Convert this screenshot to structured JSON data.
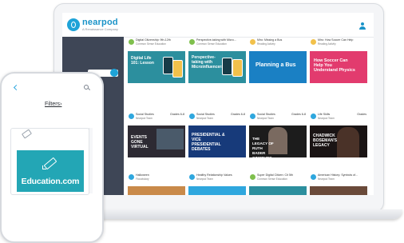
{
  "laptop": {
    "brand": "nearpod",
    "tagline": "A Renaissance Company",
    "row1": [
      {
        "title": "Digital Citizenship: 9th-12th",
        "subtitle": "Common Sense Education",
        "grade": "",
        "thumb_text": "Digital Life 101: Lesson",
        "theme": "#2c8f9e"
      },
      {
        "title": "Perspective-taking with Micro...",
        "subtitle": "Common Sense Education",
        "grade": "",
        "thumb_text": "Perspective-taking with Microinfluencers",
        "theme": "#2c8f9e"
      },
      {
        "title": "Miro: Missing a Bus",
        "subtitle": "Reading Activity",
        "grade": "",
        "thumb_text": "Planning a Bus",
        "theme": "#1a80c4"
      },
      {
        "title": "Miro: How Soccer Can Help",
        "subtitle": "Reading Activity",
        "grade": "",
        "thumb_text": "How Soccer Can Help You Understand Physics",
        "theme": "#e23b6e"
      }
    ],
    "row2": [
      {
        "title": "Social Studies",
        "subtitle": "Nearpod Team",
        "grade": "Grades 6-8",
        "thumb_text": "EVENTS GONE VIRTUAL",
        "theme": "#2d2a33"
      },
      {
        "title": "Social Studies",
        "subtitle": "Nearpod Team",
        "grade": "Grades 6-8",
        "thumb_text": "PRESIDENTIAL & VICE PRESIDENTIAL DEBATES",
        "theme": "#173a7a"
      },
      {
        "title": "Social Studies",
        "subtitle": "Nearpod Team",
        "grade": "Grades 6-8",
        "thumb_text": "THE LEGACY OF RUTH BADER GINSBURG",
        "theme": "#1c1c1c"
      },
      {
        "title": "Life Skills",
        "subtitle": "Nearpod Team",
        "grade": "Grades",
        "thumb_text": "CHADWICK BOSEMAN'S LEGACY",
        "theme": "#1a1414"
      }
    ],
    "row3": [
      {
        "title": "Halloween",
        "subtitle": "Flocabulary",
        "grade": ""
      },
      {
        "title": "Healthy Relationship Values",
        "subtitle": "Nearpod Team",
        "grade": ""
      },
      {
        "title": "Super Digital Citizen: Cit 5th",
        "subtitle": "Common Sense Education",
        "grade": ""
      },
      {
        "title": "American History: Symbols of...",
        "subtitle": "Nearpod Team",
        "grade": ""
      }
    ]
  },
  "phone": {
    "filters_label": "Filters",
    "filters_chevron": "›",
    "banner_text": "Education.com",
    "colors": {
      "accent": "#2fa7de",
      "banner": "#23a6b5"
    }
  }
}
